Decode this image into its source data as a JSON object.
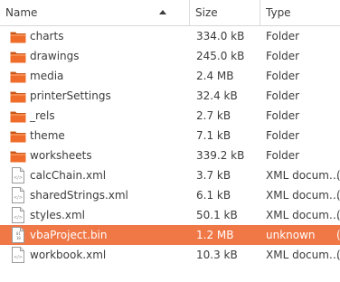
{
  "columns": {
    "name": "Name",
    "size": "Size",
    "type": "Type"
  },
  "colors": {
    "selection": "#f07746",
    "folder": "#e8631a"
  },
  "files": [
    {
      "name": "charts",
      "size": "334.0 kB",
      "type": "Folder",
      "kind": "folder",
      "icon": "folder-icon",
      "selected": false
    },
    {
      "name": "drawings",
      "size": "245.0 kB",
      "type": "Folder",
      "kind": "folder",
      "icon": "folder-icon",
      "selected": false
    },
    {
      "name": "media",
      "size": "2.4 MB",
      "type": "Folder",
      "kind": "folder",
      "icon": "folder-icon",
      "selected": false
    },
    {
      "name": "printerSettings",
      "size": "32.4 kB",
      "type": "Folder",
      "kind": "folder",
      "icon": "folder-icon",
      "selected": false
    },
    {
      "name": "_rels",
      "size": "2.7 kB",
      "type": "Folder",
      "kind": "folder",
      "icon": "folder-icon",
      "selected": false
    },
    {
      "name": "theme",
      "size": "7.1 kB",
      "type": "Folder",
      "kind": "folder",
      "icon": "folder-icon",
      "selected": false
    },
    {
      "name": "worksheets",
      "size": "339.2 kB",
      "type": "Folder",
      "kind": "folder",
      "icon": "folder-icon",
      "selected": false
    },
    {
      "name": "calcChain.xml",
      "size": "3.7 kB",
      "type": "XML docum…",
      "kind": "xml",
      "icon": "xml-file-icon",
      "selected": false
    },
    {
      "name": "sharedStrings.xml",
      "size": "6.1 kB",
      "type": "XML docum…",
      "kind": "xml",
      "icon": "xml-file-icon",
      "selected": false
    },
    {
      "name": "styles.xml",
      "size": "50.1 kB",
      "type": "XML docum…",
      "kind": "xml",
      "icon": "xml-file-icon",
      "selected": false
    },
    {
      "name": "vbaProject.bin",
      "size": "1.2 MB",
      "type": "unknown",
      "kind": "bin",
      "icon": "binary-file-icon",
      "selected": true
    },
    {
      "name": "workbook.xml",
      "size": "10.3 kB",
      "type": "XML docum…",
      "kind": "xml",
      "icon": "xml-file-icon",
      "selected": false
    }
  ],
  "trailing_glyph": "("
}
